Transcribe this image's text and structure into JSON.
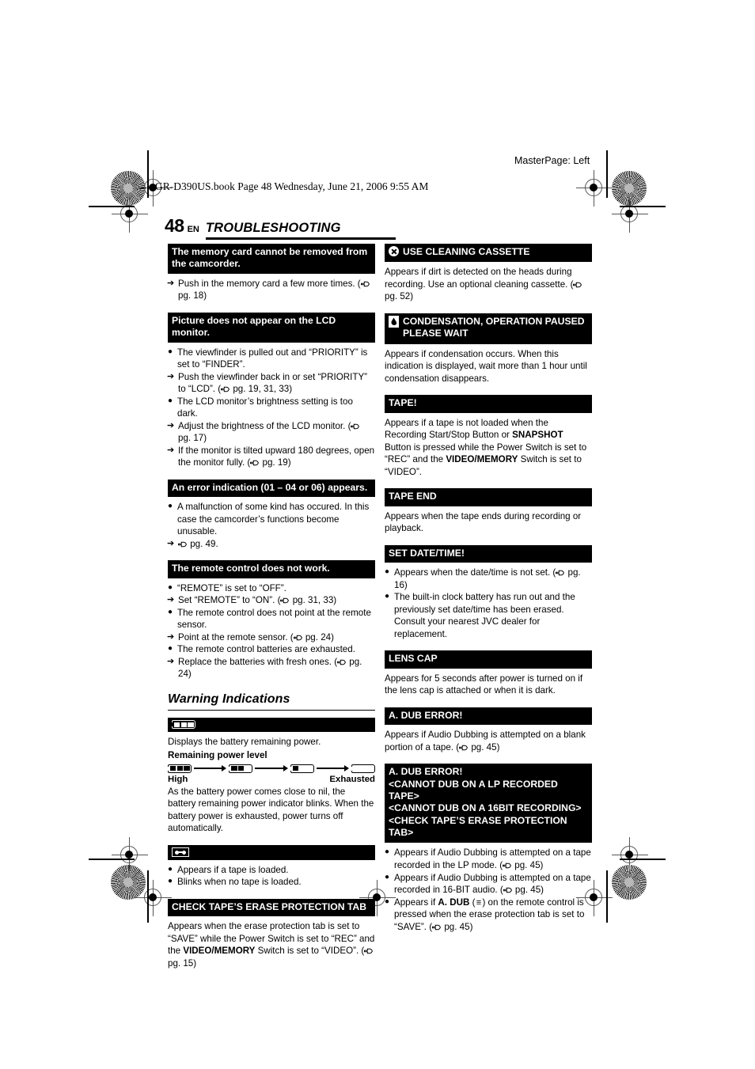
{
  "print_marks": {
    "master_page": "MasterPage: Left",
    "book_line": "GR-D390US.book  Page 48  Wednesday, June 21, 2006  9:55 AM"
  },
  "header": {
    "page_number": "48",
    "language_code": "EN",
    "chapter_title": "TROUBLESHOOTING"
  },
  "left_column": {
    "blocks": [
      {
        "bar": "The memory card cannot be removed from the camcorder.",
        "items": [
          {
            "marker": "arrow",
            "text": "Push in the memory card a few more times. (",
            "pgref": "pg. 18",
            "tail": ")"
          }
        ]
      },
      {
        "bar": "Picture does not appear on the LCD monitor.",
        "items": [
          {
            "marker": "bullet",
            "text": "The viewfinder is pulled out and “PRIORITY” is set to “FINDER”."
          },
          {
            "marker": "arrow",
            "text": "Push the viewfinder back in or set “PRIORITY” to “LCD”. (",
            "pgref": "pg. 19, 31, 33",
            "tail": ")"
          },
          {
            "marker": "bullet",
            "text": "The LCD monitor’s brightness setting is too dark."
          },
          {
            "marker": "arrow",
            "text": "Adjust the brightness of the LCD monitor. (",
            "pgref": "pg. 17",
            "tail": ")"
          },
          {
            "marker": "arrow",
            "text": "If the monitor is tilted upward 180 degrees, open the monitor fully. (",
            "pgref": "pg. 19",
            "tail": ")"
          }
        ]
      },
      {
        "bar": "An error indication (01 – 04 or 06) appears.",
        "items": [
          {
            "marker": "bullet",
            "text": "A malfunction of some kind has occured. In this case the camcorder’s functions become unusable."
          },
          {
            "marker": "arrow",
            "text": "",
            "pgref": "pg. 49.",
            "tail": ""
          }
        ]
      },
      {
        "bar": "The remote control does not work.",
        "items": [
          {
            "marker": "bullet",
            "text": "“REMOTE” is set to “OFF”."
          },
          {
            "marker": "arrow",
            "text": "Set “REMOTE” to “ON”. (",
            "pgref": "pg. 31, 33",
            "tail": ")"
          },
          {
            "marker": "bullet",
            "text": "The remote control does not point at the remote sensor."
          },
          {
            "marker": "arrow",
            "text": "Point at the remote sensor. (",
            "pgref": "pg. 24",
            "tail": ")"
          },
          {
            "marker": "bullet",
            "text": "The remote control batteries are exhausted."
          },
          {
            "marker": "arrow",
            "text": "Replace the batteries with fresh ones. (",
            "pgref": "pg. 24",
            "tail": ")"
          }
        ]
      }
    ],
    "warning_section": {
      "title": "Warning Indications",
      "battery_block": {
        "bar_icon": "battery-icon",
        "intro": "Displays the battery remaining power.",
        "level_label": "Remaining power level",
        "levels": [
          {
            "name": "battery-full-icon",
            "filled": 3
          },
          {
            "name": "battery-two-thirds-icon",
            "filled": 2
          },
          {
            "name": "battery-one-third-icon",
            "filled": 1
          },
          {
            "name": "battery-empty-icon",
            "filled": 0
          }
        ],
        "end_label_left": "High",
        "end_label_right": "Exhausted",
        "note": "As the battery power comes close to nil, the battery remaining power indicator blinks. When the battery power is exhausted, power turns off automatically."
      },
      "tape_block": {
        "bar_icon": "tape-cassette-icon",
        "items": [
          {
            "marker": "bullet",
            "text": "Appears if a tape is loaded."
          },
          {
            "marker": "bullet",
            "text": "Blinks when no tape is loaded."
          }
        ]
      },
      "erase_tab_block": {
        "bar": "CHECK TAPE’S ERASE PROTECTION TAB",
        "paragraph_1": "Appears when the erase protection tab is set to “SAVE” while the Power Switch is set to “REC” and the ",
        "bold_1": "VIDEO/MEMORY",
        "paragraph_2": " Switch is set to “VIDEO”. (",
        "pgref": "pg. 15",
        "tail": ")"
      }
    }
  },
  "right_column": {
    "blocks": [
      {
        "icon": "x-circle-icon",
        "bar": "USE CLEANING CASSETTE",
        "paragraph_1": "Appears if dirt is detected on the heads during recording. Use an optional cleaning cassette. (",
        "pgref": "pg. 52",
        "tail": ")"
      },
      {
        "icon": "condensation-droplet-icon",
        "bar": "CONDENSATION, OPERATION PAUSED PLEASE WAIT",
        "paragraph_1": "Appears if condensation occurs. When this indication is displayed, wait more than 1 hour until condensation disappears."
      },
      {
        "bar": "TAPE!",
        "paragraph_1": "Appears if a tape is not loaded when the Recording Start/Stop Button or ",
        "bold_1": "SNAPSHOT",
        "paragraph_2": " Button is pressed while the Power Switch is set to “REC” and the ",
        "bold_2": "VIDEO/MEMORY",
        "paragraph_3": " Switch is set to “VIDEO”."
      },
      {
        "bar": "TAPE END",
        "paragraph_1": "Appears when the tape ends during recording or playback."
      },
      {
        "bar": "SET DATE/TIME!",
        "items": [
          {
            "marker": "bullet",
            "text": "Appears when the date/time is not set. (",
            "pgref": "pg. 16",
            "tail": ")"
          },
          {
            "marker": "bullet",
            "text": "The built-in clock battery has run out and the previously set date/time has been erased. Consult your nearest JVC dealer for replacement."
          }
        ]
      },
      {
        "bar": "LENS CAP",
        "paragraph_1": "Appears for 5 seconds after power is turned on if the lens cap is attached or when it is dark."
      },
      {
        "bar": "A. DUB ERROR!",
        "paragraph_1": "Appears if Audio Dubbing is attempted on a blank portion of a tape. (",
        "pgref": "pg. 45",
        "tail": ")"
      },
      {
        "bar_lines": [
          "A. DUB ERROR!",
          "<CANNOT DUB ON A LP RECORDED TAPE>",
          "<CANNOT DUB ON A 16BIT RECORDING>",
          "<CHECK TAPE’S ERASE PROTECTION TAB>"
        ],
        "items": [
          {
            "marker": "bullet",
            "text": "Appears if Audio Dubbing is attempted on a tape recorded in the LP mode. (",
            "pgref": "pg. 45",
            "tail": ")"
          },
          {
            "marker": "bullet",
            "text": "Appears if Audio Dubbing is attempted on a tape recorded in 16-BIT audio. (",
            "pgref": "pg. 45",
            "tail": ")"
          },
          {
            "marker": "bullet",
            "text": "Appears if ",
            "bold_1": "A. DUB",
            "mid": " (",
            "glyph": "up-down-arrow-icon",
            "mid_2": ") on the remote control is pressed when the erase protection tab is set to “SAVE”. (",
            "pgref": "pg. 45",
            "tail": ")"
          }
        ]
      }
    ]
  }
}
